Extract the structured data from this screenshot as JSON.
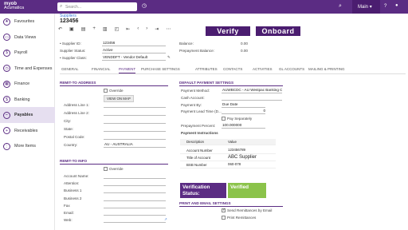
{
  "topbar": {
    "logo_line1": "myob",
    "logo_line2": "Acumatica",
    "search_placeholder": "Search...",
    "company": "Main",
    "company_icon": "chevron-down-icon"
  },
  "sidebar": {
    "items": [
      {
        "label": "Favourites",
        "icon": "star-icon",
        "glyph": "★"
      },
      {
        "label": "Data Views",
        "icon": "monitor-icon",
        "glyph": "▭"
      },
      {
        "label": "Payroll",
        "icon": "payroll-icon",
        "glyph": "$"
      },
      {
        "label": "Time and Expenses",
        "icon": "clock-icon",
        "glyph": "◷"
      },
      {
        "label": "Finance",
        "icon": "finance-icon",
        "glyph": "▦"
      },
      {
        "label": "Banking",
        "icon": "bank-icon",
        "glyph": "$"
      },
      {
        "label": "Payables",
        "icon": "payables-icon",
        "glyph": "−"
      },
      {
        "label": "Receivables",
        "icon": "receivables-icon",
        "glyph": "+"
      },
      {
        "label": "More Items",
        "icon": "grid-icon",
        "glyph": "⋮"
      }
    ]
  },
  "header": {
    "breadcrumb": "Suppliers",
    "title": "123456"
  },
  "overlay": {
    "verify": "Verify",
    "onboard": "Onboard",
    "verification_label": "Verification Status:",
    "verification_value": "Verified"
  },
  "summary": {
    "supplier_id_label": "• Supplier ID:",
    "supplier_id": "123456",
    "status_label": "Supplier Status:",
    "status": "Active",
    "class_label": "• Supplier Class:",
    "class": "VENDDFT - Vendor Default",
    "balance_label": "Balance:",
    "balance": "0.00",
    "prepay_label": "Prepayment Balance:",
    "prepay": "0.00"
  },
  "tabs": [
    "GENERAL",
    "FINANCIAL",
    "PAYMENT",
    "PURCHASE SETTINGS",
    "ATTRIBUTES",
    "CONTACTS",
    "ACTIVITIES",
    "GL ACCOUNTS",
    "MAILING & PRINTING"
  ],
  "remit_address": {
    "title": "REMIT-TO ADDRESS",
    "override": "Override",
    "view_map": "VIEW ON MAP",
    "fields": [
      {
        "label": "Address Line 1:",
        "value": ""
      },
      {
        "label": "Address Line 2:",
        "value": ""
      },
      {
        "label": "City:",
        "value": ""
      },
      {
        "label": "State:",
        "value": ""
      },
      {
        "label": "Postal Code:",
        "value": ""
      },
      {
        "label": "Country:",
        "value": "AU - AUSTRALIA"
      }
    ]
  },
  "remit_info": {
    "title": "REMIT-TO INFO",
    "override": "Override",
    "fields": [
      {
        "label": "Account Name:",
        "value": ""
      },
      {
        "label": "Attention:",
        "value": ""
      },
      {
        "label": "Business 1",
        "value": ""
      },
      {
        "label": "Business 2",
        "value": ""
      },
      {
        "label": "Fax",
        "value": ""
      },
      {
        "label": "Email:",
        "value": ""
      },
      {
        "label": "Web:",
        "value": ""
      }
    ]
  },
  "payment": {
    "title": "DEFAULT PAYMENT SETTINGS",
    "method_label": "Payment Method:",
    "method": "AUWBCDC - AU Westpac Banking Co",
    "cash_label": "Cash Account:",
    "cash": "",
    "by_label": "Payment By:",
    "by": "Due Date",
    "lead_label": "Payment Lead Time (D...",
    "lead": "0",
    "pay_sep": "Pay Separately",
    "prepay_pct_label": "Prepayment Percent:",
    "prepay_pct": "100.000000",
    "instr_title": "Payment Instructions",
    "cols": [
      "Description",
      "Value"
    ],
    "rows": [
      [
        "Account Number",
        "123456789"
      ],
      [
        "Title of Account",
        "ABC Supplier"
      ],
      [
        "BSB Number",
        "060-078"
      ]
    ]
  },
  "print": {
    "title": "PRINT AND EMAIL SETTINGS",
    "send": "Send Remittances by Email",
    "printr": "Print Remittances"
  }
}
